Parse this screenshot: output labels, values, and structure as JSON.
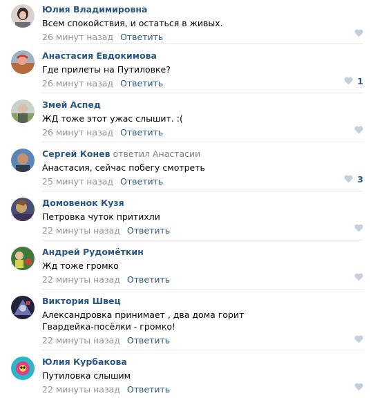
{
  "colors": {
    "author": "#2a5885",
    "meta": "#939393",
    "divider": "#e7e8ec",
    "like": "#c5d0db"
  },
  "reply_label": "Ответить",
  "comments": [
    {
      "author": "Юлия Владимировна",
      "reply_to": "",
      "lines": [
        "Всем спокойствия, и остаться в живых."
      ],
      "time": "26 минут назад",
      "likes": ""
    },
    {
      "author": "Анастасия Евдокимова",
      "reply_to": "",
      "lines": [
        "Где прилеты на Путиловке?"
      ],
      "time": "26 минут назад",
      "likes": "1"
    },
    {
      "author": "Змей Аспед",
      "reply_to": "",
      "lines": [
        "ЖД тоже этот ужас слышит. :("
      ],
      "time": "26 минут назад",
      "likes": ""
    },
    {
      "author": "Сергей Конев",
      "reply_to": "ответил Анастасии",
      "lines": [
        "Анастасия, сейчас побегу смотреть"
      ],
      "time": "25 минут назад",
      "likes": "3"
    },
    {
      "author": "Домовенок Кузя",
      "reply_to": "",
      "lines": [
        "Петровка чуток притихли"
      ],
      "time": "22 минуты назад",
      "likes": ""
    },
    {
      "author": "Андрей Рудомёткин",
      "reply_to": "",
      "lines": [
        "Жд тоже громко"
      ],
      "time": "22 минуты назад",
      "likes": ""
    },
    {
      "author": "Виктория Швец",
      "reply_to": "",
      "lines": [
        "Александровка принимает , два дома горит",
        "Гвардейка-посёлки - громко!"
      ],
      "time": "22 минуты назад",
      "likes": ""
    },
    {
      "author": "Юлия Курбакова",
      "reply_to": "",
      "lines": [
        "Путиловка слышим"
      ],
      "time": "22 минуты назад",
      "likes": ""
    }
  ]
}
